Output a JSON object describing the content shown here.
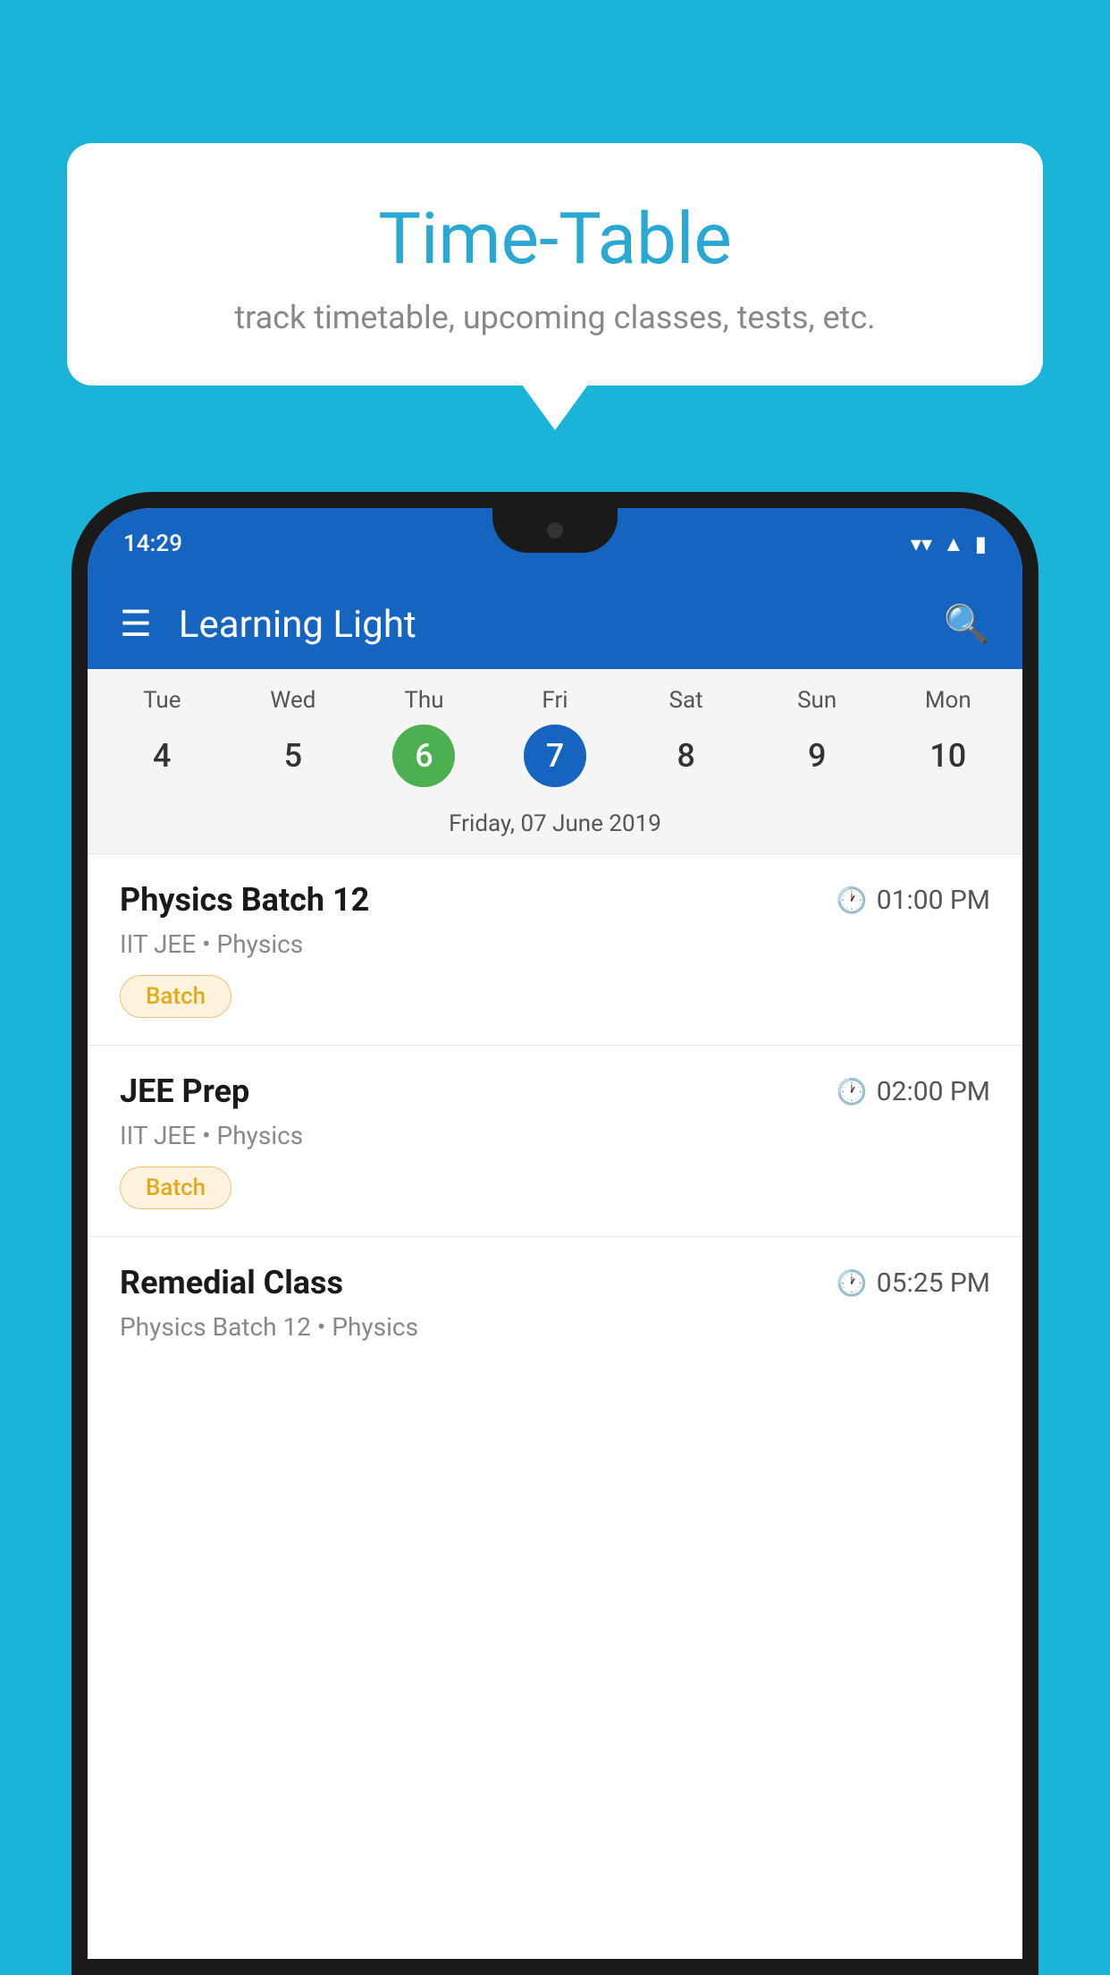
{
  "background_color": "#1ab4d8",
  "bubble": {
    "title": "Time-Table",
    "subtitle": "track timetable, upcoming classes, tests, etc."
  },
  "phone": {
    "status_bar": {
      "time": "14:29"
    },
    "app_bar": {
      "title": "Learning Light",
      "menu_icon": "☰",
      "search_icon": "⌕"
    },
    "calendar": {
      "days": [
        {
          "name": "Tue",
          "number": "4",
          "state": "normal"
        },
        {
          "name": "Wed",
          "number": "5",
          "state": "normal"
        },
        {
          "name": "Thu",
          "number": "6",
          "state": "today"
        },
        {
          "name": "Fri",
          "number": "7",
          "state": "selected"
        },
        {
          "name": "Sat",
          "number": "8",
          "state": "normal"
        },
        {
          "name": "Sun",
          "number": "9",
          "state": "normal"
        },
        {
          "name": "Mon",
          "number": "10",
          "state": "normal"
        }
      ],
      "selected_date_label": "Friday, 07 June 2019"
    },
    "classes": [
      {
        "name": "Physics Batch 12",
        "time": "01:00 PM",
        "subject": "IIT JEE • Physics",
        "tag": "Batch"
      },
      {
        "name": "JEE Prep",
        "time": "02:00 PM",
        "subject": "IIT JEE • Physics",
        "tag": "Batch"
      },
      {
        "name": "Remedial Class",
        "time": "05:25 PM",
        "subject": "Physics Batch 12 • Physics",
        "tag": null
      }
    ]
  }
}
